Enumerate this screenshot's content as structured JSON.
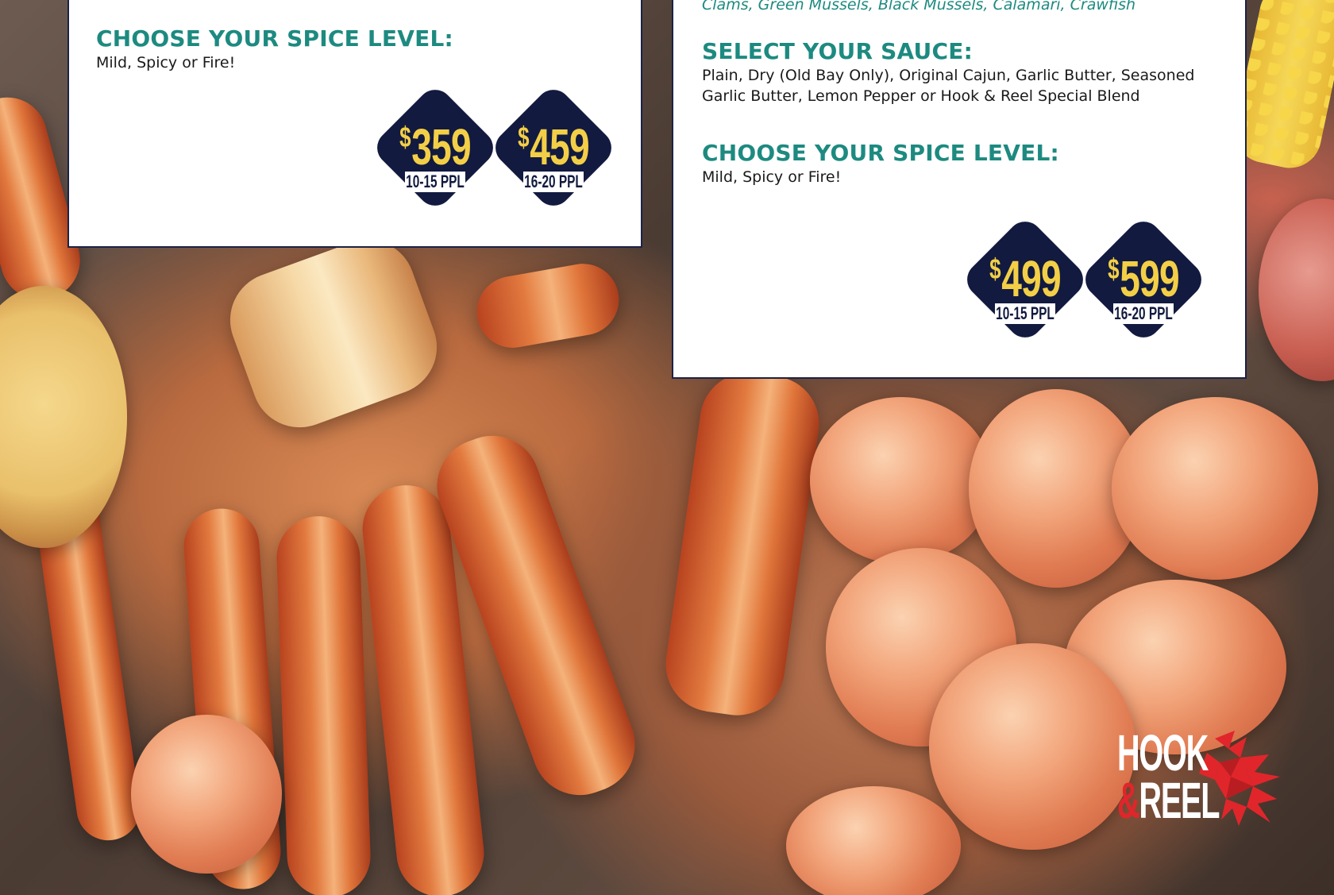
{
  "left_card": {
    "spice_heading": "CHOOSE YOUR SPICE LEVEL:",
    "spice_options": "Mild, Spicy or Fire!",
    "prices": [
      {
        "currency": "$",
        "amount": "359",
        "people": "10-15 PPL"
      },
      {
        "currency": "$",
        "amount": "459",
        "people": "16-20 PPL"
      }
    ]
  },
  "right_card": {
    "seafood_list": "Clams, Green Mussels, Black Mussels, Calamari, Crawfish",
    "sauce_heading": "SELECT YOUR SAUCE:",
    "sauce_line1": "Plain, Dry (Old Bay Only), Original Cajun, Garlic Butter, Seasoned",
    "sauce_line2": "Garlic Butter, Lemon Pepper or Hook & Reel Special Blend",
    "spice_heading": "CHOOSE YOUR SPICE LEVEL:",
    "spice_options": "Mild, Spicy or Fire!",
    "prices": [
      {
        "currency": "$",
        "amount": "499",
        "people": "10-15 PPL"
      },
      {
        "currency": "$",
        "amount": "599",
        "people": "16-20 PPL"
      }
    ]
  },
  "logo": {
    "line1": "HOOK",
    "ampersand": "&",
    "line2": "REEL"
  },
  "colors": {
    "heading": "#1d8a80",
    "badge_navy": "#121a3f",
    "badge_gold": "#f3cf47",
    "logo_red": "#e0262b"
  }
}
